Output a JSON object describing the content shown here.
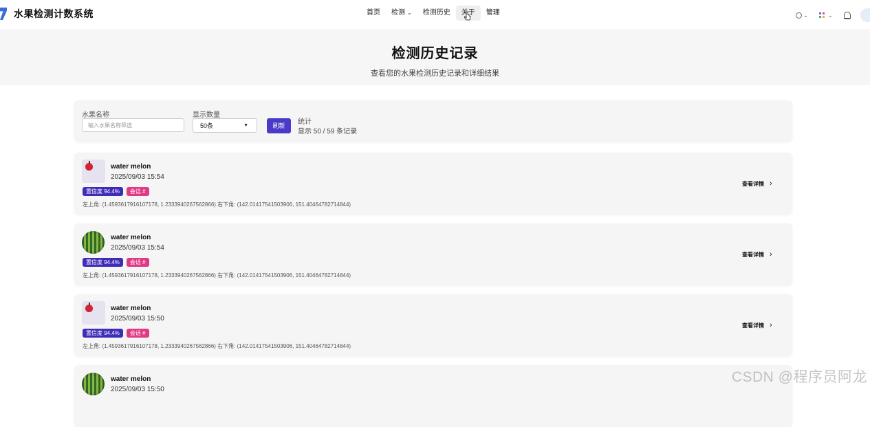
{
  "app": {
    "title": "水果检测计数系统"
  },
  "nav": {
    "items": [
      {
        "label": "首页"
      },
      {
        "label": "检测",
        "dropdown": true
      },
      {
        "label": "检测历史"
      },
      {
        "label": "关于"
      },
      {
        "label": "管理"
      }
    ]
  },
  "tools": {
    "language_icon": "globe-icon",
    "apps_icon": "apps-grid-icon",
    "notification_icon": "bell-icon"
  },
  "hero": {
    "title": "检测历史记录",
    "subtitle": "查看您的水果检测历史记录和详细结果"
  },
  "filter": {
    "fruit_name_label": "水果名称",
    "fruit_name_placeholder": "输入水果名称筛选",
    "count_label": "显示数量",
    "count_value": "50条",
    "refresh_label": "刷新",
    "stats_label": "统计",
    "stats_value": "显示 50 / 59 条记录"
  },
  "records": [
    {
      "name": "water melon",
      "time": "2025/09/03 15:54",
      "confidence": "置信度 94.4%",
      "session": "会话 #",
      "coords": "左上角: (1.4593617916107178, 1.2333940267562866) 右下角: (142.01417541503906, 151.40464782714844)",
      "detail": "查看详情",
      "thumb": "apple"
    },
    {
      "name": "water melon",
      "time": "2025/09/03 15:54",
      "confidence": "置信度 94.4%",
      "session": "会话 #",
      "coords": "左上角: (1.4593617916107178, 1.2333940267562866) 右下角: (142.01417541503906, 151.40464782714844)",
      "detail": "查看详情",
      "thumb": "watermelon"
    },
    {
      "name": "water melon",
      "time": "2025/09/03 15:50",
      "confidence": "置信度 94.4%",
      "session": "会话 #",
      "coords": "左上角: (1.4593617916107178, 1.2333940267562866) 右下角: (142.01417541503906, 151.40464782714844)",
      "detail": "查看详情",
      "thumb": "apple"
    },
    {
      "name": "water melon",
      "time": "2025/09/03 15:50",
      "thumb": "watermelon"
    }
  ],
  "watermark": "CSDN @程序员阿龙",
  "colors": {
    "primary": "#4a3ac8",
    "confidence_tag": "#3f2db8",
    "session_tag": "#e03a86",
    "brand": "#3b6bd8"
  }
}
